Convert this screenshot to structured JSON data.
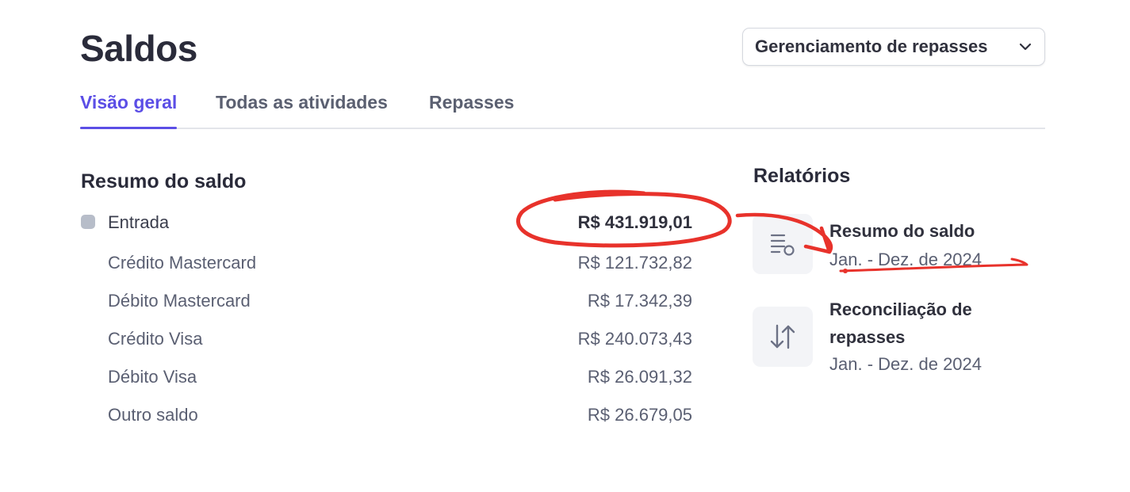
{
  "header": {
    "title": "Saldos",
    "payout_button_label": "Gerenciamento de repasses",
    "payout_button_icon": "chevron-down-icon"
  },
  "tabs": [
    {
      "label": "Visão geral",
      "active": true
    },
    {
      "label": "Todas as atividades",
      "active": false
    },
    {
      "label": "Repasses",
      "active": false
    }
  ],
  "summary": {
    "title": "Resumo do saldo",
    "main_row": {
      "label": "Entrada",
      "value": "R$ 431.919,01"
    },
    "rows": [
      {
        "label": "Crédito Mastercard",
        "value": "R$ 121.732,82"
      },
      {
        "label": "Débito Mastercard",
        "value": "R$ 17.342,39"
      },
      {
        "label": "Crédito Visa",
        "value": "R$ 240.073,43"
      },
      {
        "label": "Débito Visa",
        "value": "R$ 26.091,32"
      },
      {
        "label": "Outro saldo",
        "value": "R$ 26.679,05"
      }
    ]
  },
  "reports": {
    "title": "Relatórios",
    "items": [
      {
        "title": "Resumo do saldo",
        "subtitle": "Jan. - Dez. de 2024",
        "icon": "report-list-icon"
      },
      {
        "title": "Reconciliação de repasses",
        "subtitle": "Jan. - Dez. de 2024",
        "icon": "arrows-up-down-icon"
      }
    ]
  },
  "colors": {
    "accent": "#5b4ee6",
    "annotation": "#e8322b",
    "swatch": "#b7bdc9"
  }
}
